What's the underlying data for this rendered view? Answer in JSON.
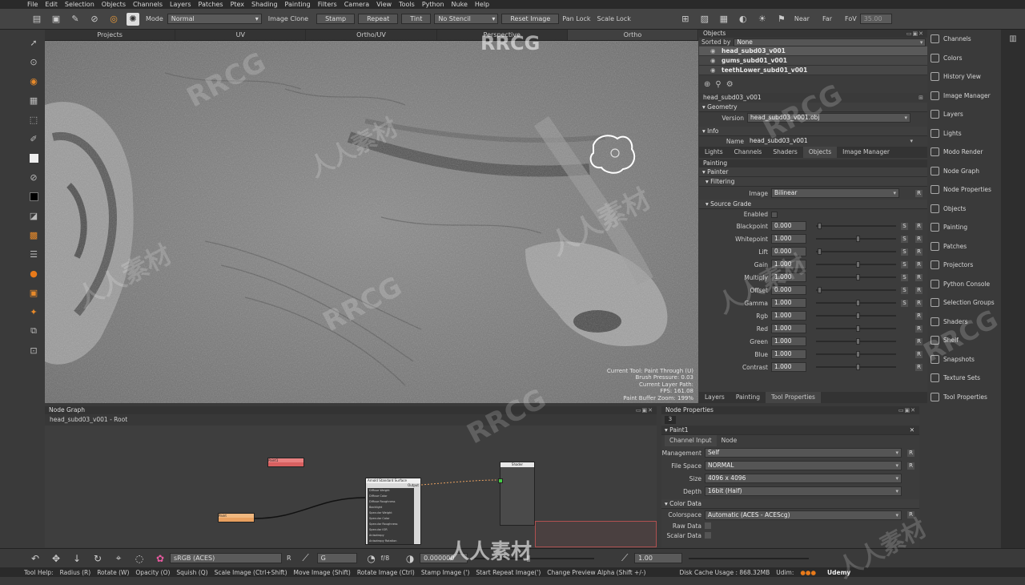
{
  "menu": [
    "File",
    "Edit",
    "Selection",
    "Objects",
    "Channels",
    "Layers",
    "Patches",
    "Ptex",
    "Shading",
    "Painting",
    "Filters",
    "Camera",
    "View",
    "Tools",
    "Python",
    "Nuke",
    "Help"
  ],
  "toolbar": {
    "mode_label": "Mode",
    "mode_value": "Normal",
    "image_clone": "Image Clone",
    "stamp": "Stamp",
    "repeat": "Repeat",
    "tint": "Tint",
    "no_stencil": "No Stencil",
    "reset_image": "Reset Image",
    "pan_lock": "Pan Lock",
    "scale_lock": "Scale Lock",
    "near": "Near",
    "far": "Far",
    "fov": "FoV",
    "fov_value": "35.00"
  },
  "viewport": {
    "tabs": [
      "Projects",
      "UV",
      "Ortho/UV",
      "Perspective",
      "Ortho"
    ],
    "active_tab": "Ortho",
    "hud": [
      "Current Tool: Paint Through (U)",
      "Brush Pressure: 0.03",
      "Current Layer Path:",
      "FPS: 161.08",
      "Paint Buffer Zoom: 199%"
    ]
  },
  "objects_panel": {
    "title": "Objects",
    "sorted_by_label": "Sorted by",
    "sorted_by_value": "None",
    "items": [
      "head_subd03_v001",
      "gums_subd01_v001",
      "teethLower_subd01_v001"
    ]
  },
  "object_props": {
    "name_header": "head_subd03_v001",
    "geometry": "Geometry",
    "version_label": "Version",
    "version_value": "head_subd03_v001.obj",
    "info": "Info",
    "name_label": "Name",
    "name_value": "head_subd03_v001",
    "tabs": [
      "Lights",
      "Channels",
      "Shaders",
      "Objects",
      "Image Manager"
    ],
    "active_tab": "Objects"
  },
  "painting_panel": {
    "title": "Painting",
    "painter": "Painter",
    "filtering": "Filtering",
    "image_label": "Image",
    "image_value": "Bilinear",
    "source_grade": "Source Grade",
    "enabled": "Enabled",
    "params": [
      {
        "label": "Blackpoint",
        "value": "0.000",
        "s": true
      },
      {
        "label": "Whitepoint",
        "value": "1.000",
        "s": true
      },
      {
        "label": "Lift",
        "value": "0.000",
        "s": true
      },
      {
        "label": "Gain",
        "value": "1.000",
        "s": true
      },
      {
        "label": "Multiply",
        "value": "1.000",
        "s": true
      },
      {
        "label": "Offset",
        "value": "0.000",
        "s": true
      },
      {
        "label": "Gamma",
        "value": "1.000",
        "s": true
      },
      {
        "label": "Rgb",
        "value": "1.000",
        "s": false
      },
      {
        "label": "Red",
        "value": "1.000",
        "s": false
      },
      {
        "label": "Green",
        "value": "1.000",
        "s": false
      },
      {
        "label": "Blue",
        "value": "1.000",
        "s": false
      },
      {
        "label": "Contrast",
        "value": "1.000",
        "s": false
      }
    ],
    "tabs": [
      "Layers",
      "Painting",
      "Tool Properties"
    ],
    "active_tab": "Tool Properties"
  },
  "right_sidebar": [
    "Channels",
    "Colors",
    "History View",
    "Image Manager",
    "Layers",
    "Lights",
    "Modo Render",
    "Node Graph",
    "Node Properties",
    "Objects",
    "Painting",
    "Patches",
    "Projectors",
    "Python Console",
    "Selection Groups",
    "Shaders",
    "Shelf",
    "Snapshots",
    "Texture Sets",
    "Tool Properties"
  ],
  "node_graph": {
    "title": "Node Graph",
    "path": "head_subd03_v001 - Root",
    "nodes": {
      "red": "Paint1",
      "orange": "Paint",
      "shader": "Arnold Standard Surface",
      "shader_out": "Output",
      "merge": "Shader"
    },
    "shader_inputs": [
      "Diffuse Weight",
      "Diffuse Color",
      "Diffuse Roughness",
      "Backlight",
      "Specular Weight",
      "Specular Color",
      "Specular Roughness",
      "Specular IOR",
      "Anisotropy",
      "Anisotropy Rotation"
    ]
  },
  "node_props": {
    "title": "Node Properties",
    "paint_node": "Paint1",
    "tab_channel": "Channel Input",
    "tab_node": "Node",
    "rows": [
      {
        "label": "Management",
        "value": "Self"
      },
      {
        "label": "File Space",
        "value": "NORMAL"
      },
      {
        "label": "Size",
        "value": "4096 x 4096"
      },
      {
        "label": "Depth",
        "value": "16bit (Half)"
      }
    ],
    "color_data": "Color Data",
    "colorspace_label": "Colorspace",
    "colorspace_value": "Automatic (ACES - ACEScg)",
    "raw_data": "Raw Data",
    "scalar_data": "Scalar Data"
  },
  "bottom_bar": {
    "colorspace": "sRGB (ACES)",
    "r": "R",
    "channel": "G",
    "fstop": "f/8",
    "gain": "0.000000",
    "zoom": "1.00"
  },
  "status": {
    "tool_help": "Tool Help:",
    "hints": [
      "Radius (R)",
      "Rotate (W)",
      "Opacity (O)",
      "Squish (Q)",
      "Scale Image (Ctrl+Shift)",
      "Move Image (Shift)",
      "Rotate Image (Ctrl)",
      "Stamp Image (')",
      "Start Repeat Image(')",
      "Change Preview Alpha (Shift +/-)"
    ],
    "disk_cache": "Disk Cache Usage : 868.32MB",
    "udim": "Udim:",
    "brand": "Udemy"
  },
  "watermarks": [
    "RRCG",
    "人人素材",
    "RRCG",
    "人人素材",
    "RRCG",
    "人人素材",
    "RRCG",
    "人人素材",
    "RRCG",
    "人人素材",
    "RRCG",
    "人人素材"
  ]
}
